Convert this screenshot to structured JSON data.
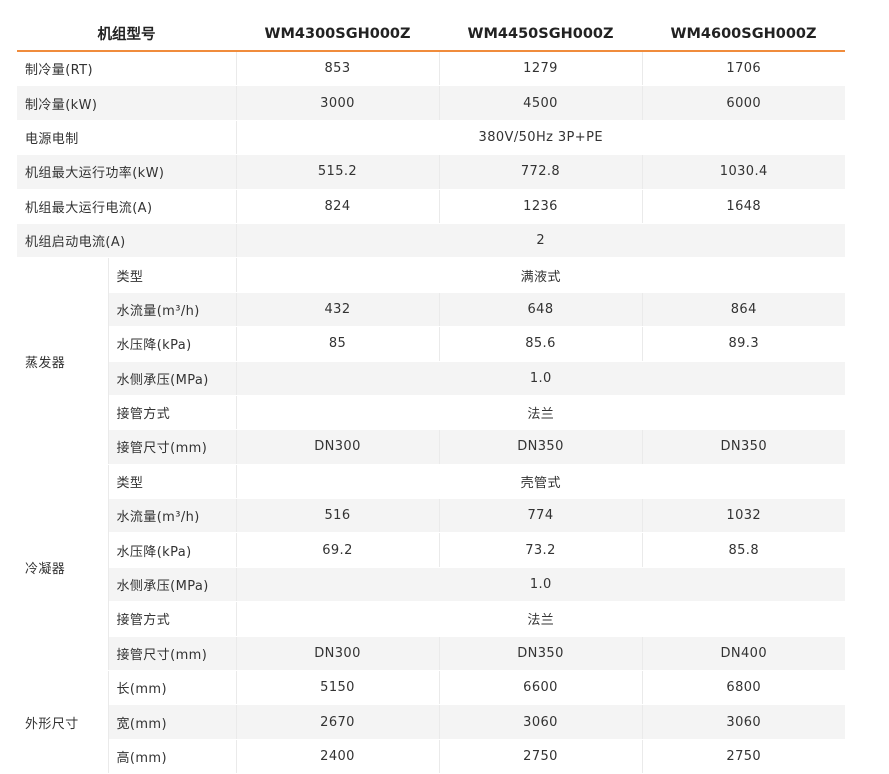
{
  "table": {
    "headers": [
      "机组型号",
      "WM4300SGH000Z",
      "WM4450SGH000Z",
      "WM4600SGH000Z"
    ],
    "rows": [
      {
        "label": "制冷量(RT)",
        "values": [
          "853",
          "1279",
          "1706"
        ]
      },
      {
        "label": "制冷量(kW)",
        "values": [
          "3000",
          "4500",
          "6000"
        ]
      },
      {
        "label": "电源电制",
        "values": [
          "380V/50Hz 3P+PE"
        ]
      },
      {
        "label": "机组最大运行功率(kW)",
        "values": [
          "515.2",
          "772.8",
          "1030.4"
        ]
      },
      {
        "label": "机组最大运行电流(A)",
        "values": [
          "824",
          "1236",
          "1648"
        ]
      },
      {
        "label": "机组启动电流(A)",
        "values": [
          "2"
        ]
      },
      {
        "group": "蒸发器",
        "label": "类型",
        "values": [
          "满液式"
        ]
      },
      {
        "label": "水流量(m³/h)",
        "values": [
          "432",
          "648",
          "864"
        ]
      },
      {
        "label": "水压降(kPa)",
        "values": [
          "85",
          "85.6",
          "89.3"
        ]
      },
      {
        "label": "水侧承压(MPa)",
        "values": [
          "1.0"
        ]
      },
      {
        "label": "接管方式",
        "values": [
          "法兰"
        ]
      },
      {
        "label": "接管尺寸(mm)",
        "values": [
          "DN300",
          "DN350",
          "DN350"
        ]
      },
      {
        "group": "冷凝器",
        "label": "类型",
        "values": [
          "壳管式"
        ]
      },
      {
        "label": "水流量(m³/h)",
        "values": [
          "516",
          "774",
          "1032"
        ]
      },
      {
        "label": "水压降(kPa)",
        "values": [
          "69.2",
          "73.2",
          "85.8"
        ]
      },
      {
        "label": "水侧承压(MPa)",
        "values": [
          "1.0"
        ]
      },
      {
        "label": "接管方式",
        "values": [
          "法兰"
        ]
      },
      {
        "label": "接管尺寸(mm)",
        "values": [
          "DN300",
          "DN350",
          "DN400"
        ]
      },
      {
        "group": "外形尺寸",
        "label": "长(mm)",
        "values": [
          "5150",
          "6600",
          "6800"
        ]
      },
      {
        "label": "宽(mm)",
        "values": [
          "2670",
          "3060",
          "3060"
        ]
      },
      {
        "label": "高(mm)",
        "values": [
          "2400",
          "2750",
          "2750"
        ]
      }
    ]
  },
  "colors": {
    "header_rule": "#f08c3c",
    "stripe": "#f4f4f4"
  }
}
